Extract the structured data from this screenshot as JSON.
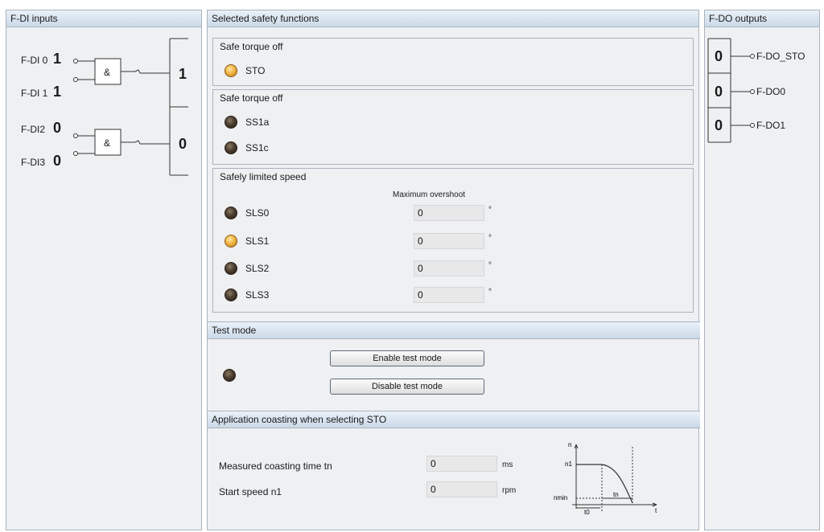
{
  "fdi_panel": {
    "title": "F-DI inputs",
    "inputs": [
      {
        "label": "F-DI 0",
        "value": "1"
      },
      {
        "label": "F-DI 1",
        "value": "1"
      },
      {
        "label": "F-DI2",
        "value": "0"
      },
      {
        "label": "F-DI3",
        "value": "0"
      }
    ],
    "gate_symbol": "&",
    "outputs": [
      "1",
      "0"
    ]
  },
  "safety_panel": {
    "title": "Selected safety functions",
    "groups": [
      {
        "title": "Safe torque off",
        "items": [
          {
            "label": "STO",
            "state": "on"
          }
        ]
      },
      {
        "title": "Safe torque off",
        "items": [
          {
            "label": "SS1a",
            "state": "off"
          },
          {
            "label": "SS1c",
            "state": "off"
          }
        ]
      },
      {
        "title": "Safely limited speed",
        "column_header": "Maximum overshoot",
        "items": [
          {
            "label": "SLS0",
            "state": "off",
            "value": "0",
            "unit": "°"
          },
          {
            "label": "SLS1",
            "state": "on",
            "value": "0",
            "unit": "°"
          },
          {
            "label": "SLS2",
            "state": "off",
            "value": "0",
            "unit": "°"
          },
          {
            "label": "SLS3",
            "state": "off",
            "value": "0",
            "unit": "°"
          }
        ]
      }
    ]
  },
  "test_mode": {
    "title": "Test mode",
    "state": "off",
    "enable_label": "Enable test mode",
    "disable_label": "Disable test mode"
  },
  "coasting": {
    "title": "Application coasting when selecting STO",
    "rows": [
      {
        "label": "Measured coasting time tn",
        "value": "0",
        "unit": "ms"
      },
      {
        "label": "Start speed n1",
        "value": "0",
        "unit": "rpm"
      }
    ],
    "diagram": {
      "n": "n",
      "n1": "n1",
      "nmin": "nmin",
      "t": "t",
      "t0": "t0",
      "tn": "tn"
    }
  },
  "fdo_panel": {
    "title": "F-DO outputs",
    "outputs": [
      {
        "value": "0",
        "label": "F-DO_STO"
      },
      {
        "value": "0",
        "label": "F-DO0"
      },
      {
        "value": "0",
        "label": "F-DO1"
      }
    ]
  }
}
